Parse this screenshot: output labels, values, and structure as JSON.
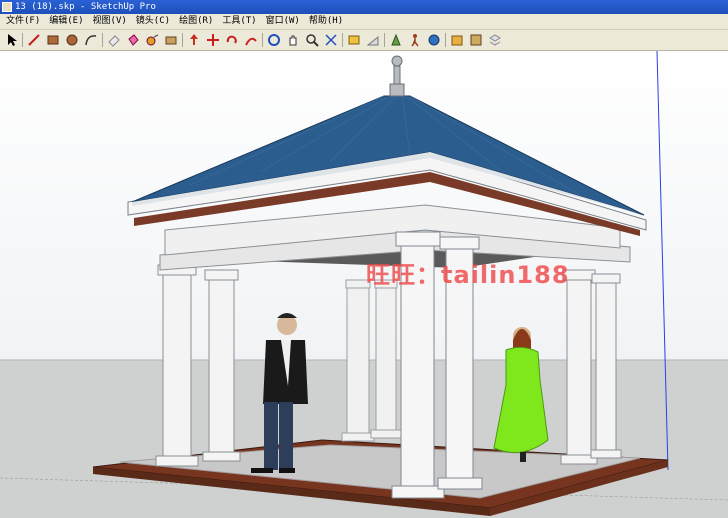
{
  "window": {
    "title": "13 (18).skp - SketchUp Pro"
  },
  "menu": [
    "文件(F)",
    "编辑(E)",
    "视图(V)",
    "镜头(C)",
    "绘图(R)",
    "工具(T)",
    "窗口(W)",
    "帮助(H)"
  ],
  "toolbar_icons": [
    "select-arrow-icon",
    "pencil-line-icon",
    "rectangle-icon",
    "circle-icon",
    "arc-icon",
    "eraser-icon",
    "paint-bucket-icon",
    "tape-measure-icon",
    "dimension-icon",
    "push-pull-icon",
    "move-icon",
    "rotate-icon",
    "follow-me-icon",
    "orbit-icon",
    "pan-icon",
    "zoom-icon",
    "zoom-extents-icon",
    "section-plane-icon",
    "axes-icon",
    "position-camera-icon",
    "walk-icon",
    "components-icon",
    "materials-icon",
    "styles-icon"
  ],
  "watermark": "旺旺：tailin188",
  "colors": {
    "roof": "#2b5d8f",
    "floor": "#7a3a28",
    "dress": "#7ee81c",
    "column": "#f2f2f2",
    "title_bar": "#2a62d6",
    "watermark": "#f04a4a"
  }
}
